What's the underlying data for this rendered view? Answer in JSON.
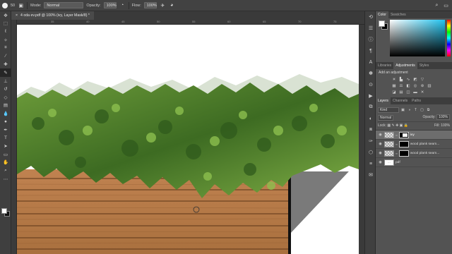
{
  "options_bar": {
    "brush_size": "50",
    "mode_label": "Mode:",
    "mode_value": "Normal",
    "opacity_label": "Opacity:",
    "opacity_value": "100%",
    "flow_label": "Flow:",
    "flow_value": "100%"
  },
  "document": {
    "tab_title": "4 oda ev.pdf @ 100% (ivy, Layer Mask/8) *",
    "close_glyph": "×",
    "ruler_marks": [
      "35",
      "40",
      "45",
      "50",
      "55",
      "60",
      "65",
      "70",
      "75",
      "80"
    ]
  },
  "panels": {
    "color_tabs": [
      "Color",
      "Swatches"
    ],
    "adjust_tabs": [
      "Libraries",
      "Adjustments",
      "Styles"
    ],
    "adjust_title": "Add an adjustment",
    "layer_tabs": [
      "Layers",
      "Channels",
      "Paths"
    ],
    "kind_label": "Kind",
    "blend_mode": "Normal",
    "opacity_label": "Opacity:",
    "opacity_value": "100%",
    "lock_label": "Lock:",
    "fill_label": "Fill:",
    "fill_value": "100%",
    "layers": [
      {
        "name": "ivy",
        "selected": true
      },
      {
        "name": "wood plank seam...",
        "selected": false
      },
      {
        "name": "wood plank seam...",
        "selected": false
      },
      {
        "name": "pdf",
        "selected": false
      }
    ]
  },
  "tools": [
    "move-tool",
    "marquee-tool",
    "lasso-tool",
    "magic-wand-tool",
    "crop-tool",
    "eyedropper-tool",
    "healing-brush-tool",
    "brush-tool",
    "clone-stamp-tool",
    "history-brush-tool",
    "eraser-tool",
    "gradient-tool",
    "blur-tool",
    "dodge-tool",
    "pen-tool",
    "type-tool",
    "path-selection-tool",
    "rectangle-tool",
    "hand-tool",
    "zoom-tool",
    "more-tools"
  ],
  "colors": {
    "foreground": "#ffffff",
    "background": "#000000",
    "canvas_bg": "#ffffff",
    "wood": "#b87a45",
    "ivy_dark": "#2f5a1c",
    "ivy_light": "#7fae45"
  }
}
